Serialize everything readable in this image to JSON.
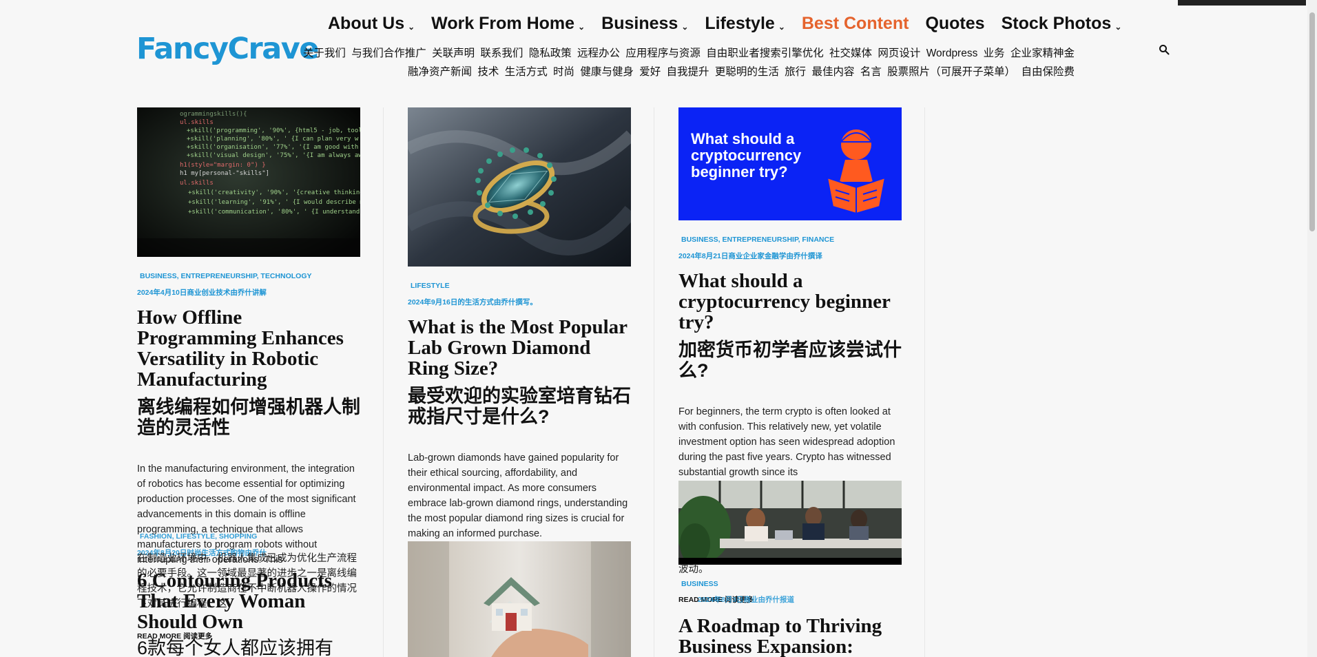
{
  "site": {
    "logo": "FancyCrave",
    "brand_color": "#1e95d4",
    "accent_color": "#e5632d"
  },
  "nav": {
    "items": [
      {
        "label": "About Us",
        "dropdown": true
      },
      {
        "label": "Work From Home",
        "dropdown": true
      },
      {
        "label": "Business",
        "dropdown": true
      },
      {
        "label": "Lifestyle",
        "dropdown": true
      },
      {
        "label": "Best Content",
        "dropdown": false,
        "active": true
      },
      {
        "label": "Quotes",
        "dropdown": false
      },
      {
        "label": "Stock Photos",
        "dropdown": true
      }
    ],
    "sub_items": [
      "关于我们",
      "与我们合作推广",
      "关联声明",
      "联系我们",
      "隐私政策",
      "远程办公",
      "应用程序与资源",
      "自由职业者搜索引擎优化",
      "社交媒体",
      "网页设计",
      "Wordpress",
      "业务",
      "企业家精神金融净资产新闻",
      "技术",
      "生活方式",
      "时尚",
      "健康与健身",
      "爱好",
      "自我提升",
      "更聪明的生活",
      "旅行",
      "最佳内容",
      "名言",
      "股票照片（可展开子菜单）",
      "自由保险费"
    ],
    "search_icon": "search-icon"
  },
  "articles": {
    "a1": {
      "image": "code-screen",
      "categories": "BUSINESS, ENTREPRENEURSHIP, TECHNOLOGY",
      "meta": "2024年4月10日商业创业技术由乔什讲解",
      "title_en": "How Offline Programming Enhances Versatility in Robotic Manufacturing",
      "title_zh": "离线编程如何增强机器人制造的灵活性",
      "excerpt": "In the manufacturing environment, the integration of robotics has become essential for optimizing production processes. One of the most significant advancements in this domain is offline programming, a technique that allows manufacturers to program robots without interrupting their operations. This",
      "excerpt_zh": "在制造业环境中，机器人集成已成为优化生产流程的必要手段。这一领域最显著的进步之一是离线编程技术，它允许制造商在不中断机器人操作的情况下对其进行编程。这",
      "read_more": "READ MORE 阅读更多"
    },
    "a4": {
      "categories": "FASHION, LIFESTYLE, SHOPPING",
      "meta": "2024年8月20日时尚生活方式购物由乔什",
      "title_en": "6 Contouring Products That Every Woman Should Own",
      "title_zh": "6款每个女人都应该拥有"
    },
    "a2": {
      "image": "diamond-ring",
      "categories": "LIFESTYLE",
      "meta": "2024年9月16日的生活方式由乔什撰写。",
      "title_en": "What is the Most Popular Lab Grown Diamond Ring Size?",
      "title_zh": "最受欢迎的实验室培育钻石戒指尺寸是什么?",
      "excerpt": "Lab-grown diamonds have gained popularity for their ethical sourcing, affordability, and environmental impact. As more consumers embrace lab-grown diamond rings, understanding the most popular diamond ring sizes is crucial for making an informed purchase."
    },
    "a5": {
      "image": "house-in-hand"
    },
    "a3": {
      "image": "crypto-banner",
      "image_text": "What should a cryptocurrency beginner try?",
      "categories": "BUSINESS, ENTREPRENEURSHIP, FINANCE",
      "meta": "2024年8月21日商业企业家金融学由乔什撰译",
      "title_en": "What should a cryptocurrency beginner try?",
      "title_zh": "加密货币初学者应该尝试什么?",
      "excerpt": "For beginners, the term crypto is often looked at with confusion. This relatively new, yet volatile investment option has seen widespread adoption during the past five years. Crypto has witnessed substantial growth since its",
      "excerpt_tail": "波动。",
      "read_more": "READ MORE 阅读更多"
    },
    "a6": {
      "image": "office-meeting",
      "categories": "BUSINESS",
      "meta": "2024年8月3日商业由乔什报道",
      "title_en": "A Roadmap to Thriving Business Expansion:"
    }
  }
}
